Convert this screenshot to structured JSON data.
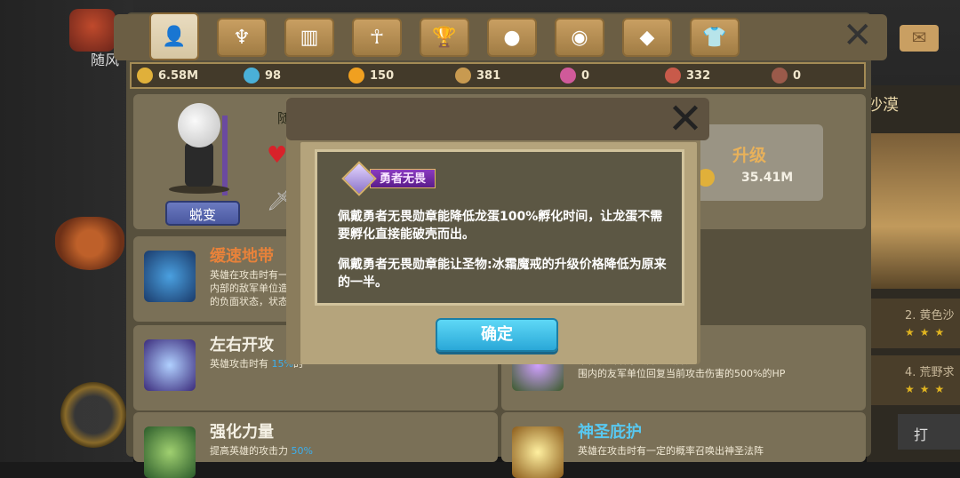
{
  "left": {
    "label": "随风"
  },
  "tabs": [
    {
      "icon": "hero-icon",
      "glyph": "👤",
      "active": true
    },
    {
      "icon": "horned-helmet-icon",
      "glyph": "♆"
    },
    {
      "icon": "fence-icon",
      "glyph": "▥"
    },
    {
      "icon": "ankh-icon",
      "glyph": "☥"
    },
    {
      "icon": "trophy-icon",
      "glyph": "🏆"
    },
    {
      "icon": "orb-icon",
      "glyph": "●"
    },
    {
      "icon": "dragon-egg-icon",
      "glyph": "◉"
    },
    {
      "icon": "gem-icon",
      "glyph": "◆"
    },
    {
      "icon": "shirt-icon",
      "glyph": "👕"
    }
  ],
  "resources": [
    {
      "name": "gold",
      "value": "6.58M",
      "color": "#e0b03a"
    },
    {
      "name": "crystal",
      "value": "98",
      "color": "#4ab0d8"
    },
    {
      "name": "orange-orb",
      "value": "150",
      "color": "#f0a020"
    },
    {
      "name": "star-shard",
      "value": "381",
      "color": "#c89a50"
    },
    {
      "name": "pink-shard",
      "value": "0",
      "color": "#d05a9a"
    },
    {
      "name": "red-shard",
      "value": "332",
      "color": "#c85a4a"
    },
    {
      "name": "dark-coin",
      "value": "0",
      "color": "#9a5a4a"
    }
  ],
  "hero": {
    "name_fragment": "随",
    "transform_label": "蜕变",
    "upgrade_label": "升级",
    "upgrade_cost": "35.41M"
  },
  "skills": [
    {
      "name": "缓速地带",
      "desc": "英雄在攻击时有一定\n内部的敌军单位造成\n的负面状态，状态持",
      "name_color": "#e8823a",
      "icon_color": "#1a3a6a"
    },
    {
      "name": "左右开攻",
      "desc_pre": "英雄攻击时有 ",
      "desc_hl": "15%",
      "desc_post": "的",
      "name_color": "#f4f0e4",
      "icon_color": "#4a3a8a"
    },
    {
      "name": "强化力量",
      "desc": "提高英雄的攻击力 ",
      "hl": "50%",
      "name_color": "#f4f0e4",
      "icon_color": "#3a6a3a"
    },
    {
      "name": "神圣庇护",
      "desc": "英雄在攻击时有一定的概率召唤出神圣法阵",
      "name_color": "#58c8f0",
      "icon_color": "#6a4a1a"
    }
  ],
  "skill_partial": {
    "desc": "率召唤出治疗法阵为法阵范\n围内的友军单位回复当前攻击伤害的500%的HP"
  },
  "right_panel": {
    "title": "沙漠",
    "row1": "2. 黄色沙",
    "row2": "4. 荒野求",
    "stars": "★★★",
    "bottom": "打"
  },
  "dialog": {
    "badge": "勇者无畏",
    "para1": "佩戴勇者无畏勋章能降低龙蛋100%孵化时间，让龙蛋不需要孵化直接能破壳而出。",
    "para2": "佩戴勇者无畏勋章能让圣物:冰霜魔戒的升级价格降低为原来的一半。",
    "confirm": "确定"
  }
}
